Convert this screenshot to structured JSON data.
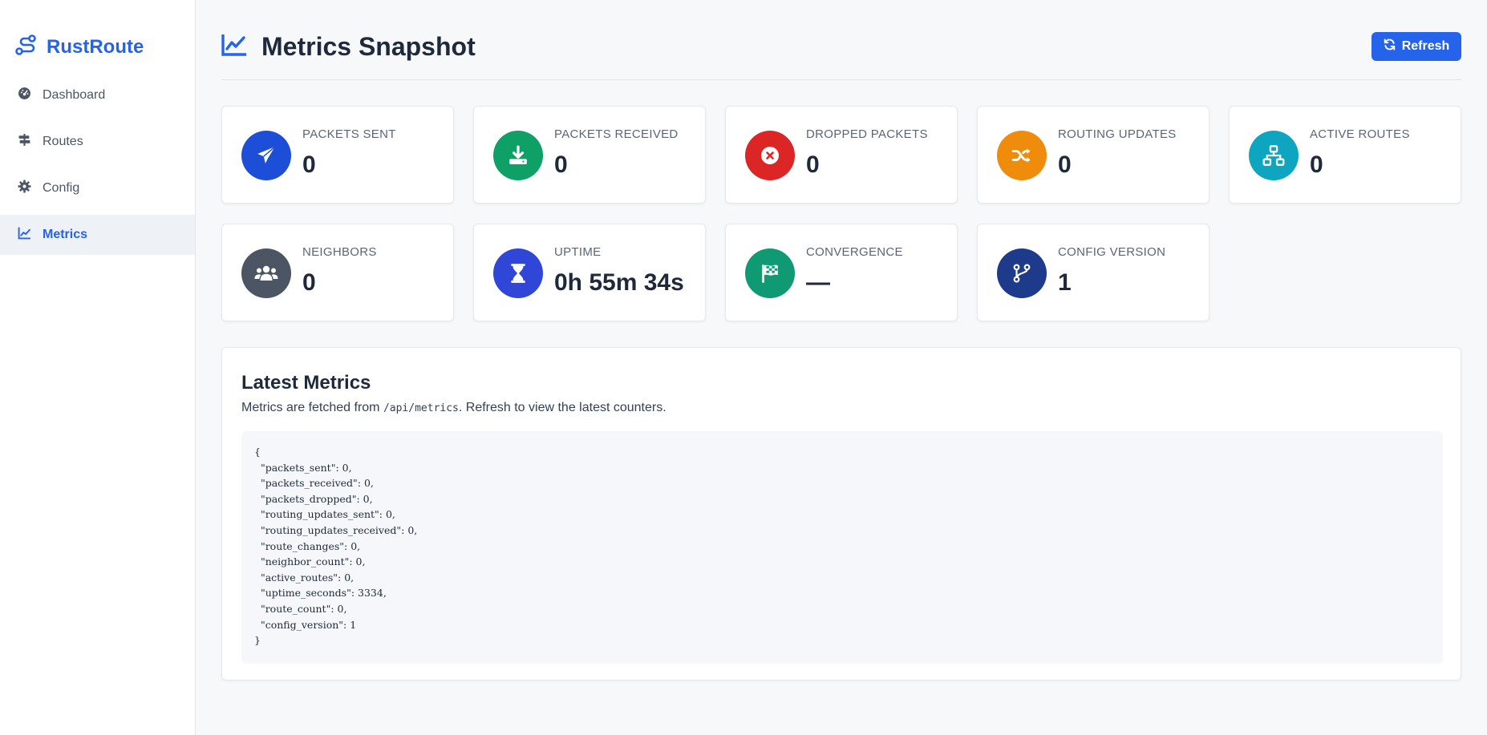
{
  "brand": {
    "name": "RustRoute",
    "icon": "route-icon"
  },
  "sidebar": {
    "items": [
      {
        "label": "Dashboard",
        "icon": "gauge-icon",
        "active": false
      },
      {
        "label": "Routes",
        "icon": "signpost-icon",
        "active": false
      },
      {
        "label": "Config",
        "icon": "gear-icon",
        "active": false
      },
      {
        "label": "Metrics",
        "icon": "chart-line-icon",
        "active": true
      }
    ]
  },
  "header": {
    "title": "Metrics Snapshot",
    "icon": "chart-line-icon",
    "refresh_label": "Refresh"
  },
  "cards": [
    {
      "label": "Packets Sent",
      "value": "0",
      "icon": "paper-plane-icon",
      "color": "#1d4ed8"
    },
    {
      "label": "Packets Received",
      "value": "0",
      "icon": "download-icon",
      "color": "#0ea066"
    },
    {
      "label": "Dropped Packets",
      "value": "0",
      "icon": "x-circle-icon",
      "color": "#dc2626"
    },
    {
      "label": "Routing Updates",
      "value": "0",
      "icon": "shuffle-icon",
      "color": "#f08c0c"
    },
    {
      "label": "Active Routes",
      "value": "0",
      "icon": "network-icon",
      "color": "#0ea5c0"
    },
    {
      "label": "Neighbors",
      "value": "0",
      "icon": "users-icon",
      "color": "#4b5563"
    },
    {
      "label": "Uptime",
      "value": "0h 55m 34s",
      "icon": "hourglass-icon",
      "color": "#3046d6"
    },
    {
      "label": "Convergence",
      "value": "—",
      "icon": "checkered-flag-icon",
      "color": "#0f9a74"
    },
    {
      "label": "Config Version",
      "value": "1",
      "icon": "code-branch-icon",
      "color": "#1e3a8a"
    }
  ],
  "latest": {
    "title": "Latest Metrics",
    "desc_prefix": "Metrics are fetched from ",
    "desc_code": "/api/metrics",
    "desc_suffix": ". Refresh to view the latest counters.",
    "json": "{\n  \"packets_sent\": 0,\n  \"packets_received\": 0,\n  \"packets_dropped\": 0,\n  \"routing_updates_sent\": 0,\n  \"routing_updates_received\": 0,\n  \"route_changes\": 0,\n  \"neighbor_count\": 0,\n  \"active_routes\": 0,\n  \"uptime_seconds\": 3334,\n  \"route_count\": 0,\n  \"config_version\": 1\n}"
  }
}
